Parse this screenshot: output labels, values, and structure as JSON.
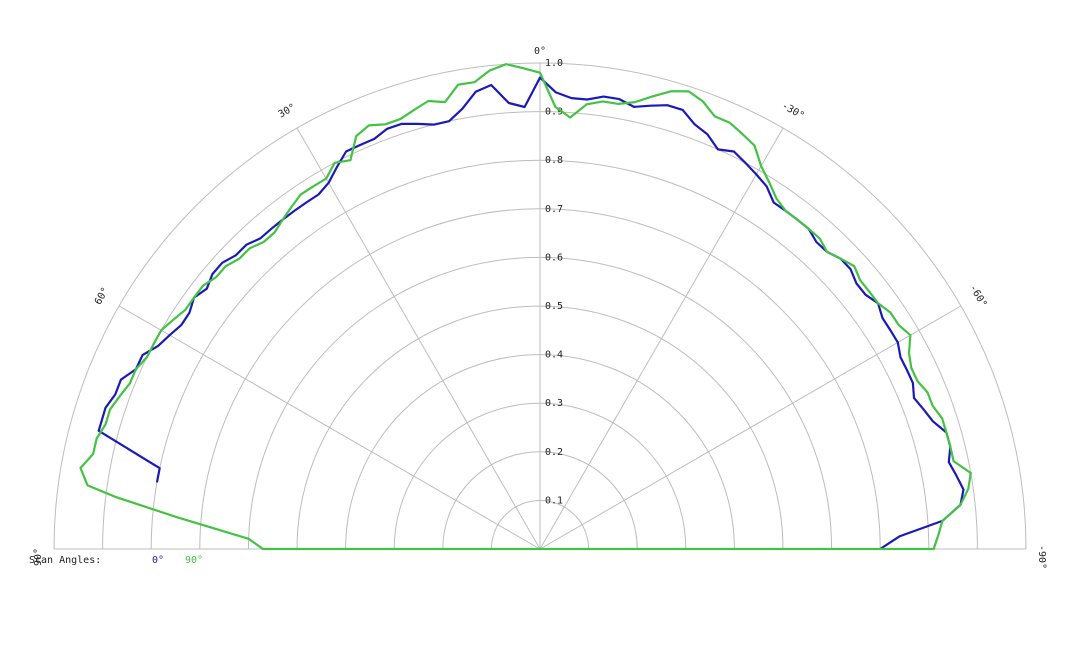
{
  "chart_data": {
    "type": "polar-line",
    "radial_range": [
      0,
      1.0
    ],
    "radial_ticks": [
      0.1,
      0.2,
      0.3,
      0.4,
      0.5,
      0.6,
      0.7,
      0.8,
      0.9,
      1.0
    ],
    "radial_tick_labels": [
      "0.1",
      "0.2",
      "0.3",
      "0.4",
      "0.5",
      "0.6",
      "0.7",
      "0.8",
      "0.9",
      "1.0"
    ],
    "angle_range": [
      -90,
      90
    ],
    "angle_ticks": [
      90,
      60,
      30,
      0,
      -30,
      -60,
      -90
    ],
    "angle_tick_labels": [
      "90°",
      "60°",
      "30°",
      "0°",
      "-30°",
      "-60°",
      "-90°"
    ],
    "grid": true,
    "legend": {
      "title": "Scan Angles:",
      "placement": "bottom-left",
      "entries": [
        "0°",
        "90°"
      ]
    },
    "series": [
      {
        "name": "0°",
        "color": "#1a1ab8",
        "points": [
          [
            80,
            0.8
          ],
          [
            78,
            0.8
          ],
          [
            75,
            0.94
          ],
          [
            72,
            0.94
          ],
          [
            70,
            0.93
          ],
          [
            68,
            0.93
          ],
          [
            66,
            0.91
          ],
          [
            64,
            0.91
          ],
          [
            62,
            0.89
          ],
          [
            60,
            0.88
          ],
          [
            58,
            0.87
          ],
          [
            56,
            0.87
          ],
          [
            54,
            0.88
          ],
          [
            52,
            0.87
          ],
          [
            50,
            0.88
          ],
          [
            48,
            0.88
          ],
          [
            46,
            0.87
          ],
          [
            44,
            0.87
          ],
          [
            42,
            0.86
          ],
          [
            40,
            0.86
          ],
          [
            38,
            0.86
          ],
          [
            36,
            0.86
          ],
          [
            34,
            0.86
          ],
          [
            32,
            0.86
          ],
          [
            30,
            0.87
          ],
          [
            28,
            0.89
          ],
          [
            26,
            0.91
          ],
          [
            24,
            0.91
          ],
          [
            22,
            0.91
          ],
          [
            20,
            0.92
          ],
          [
            18,
            0.92
          ],
          [
            16,
            0.91
          ],
          [
            14,
            0.9
          ],
          [
            12,
            0.9
          ],
          [
            10,
            0.92
          ],
          [
            8,
            0.95
          ],
          [
            6,
            0.96
          ],
          [
            4,
            0.92
          ],
          [
            2,
            0.91
          ],
          [
            0,
            0.97
          ],
          [
            -2,
            0.94
          ],
          [
            -4,
            0.93
          ],
          [
            -6,
            0.93
          ],
          [
            -8,
            0.94
          ],
          [
            -10,
            0.94
          ],
          [
            -12,
            0.93
          ],
          [
            -14,
            0.94
          ],
          [
            -16,
            0.95
          ],
          [
            -18,
            0.95
          ],
          [
            -20,
            0.93
          ],
          [
            -22,
            0.92
          ],
          [
            -24,
            0.9
          ],
          [
            -26,
            0.91
          ],
          [
            -28,
            0.9
          ],
          [
            -30,
            0.89
          ],
          [
            -32,
            0.88
          ],
          [
            -34,
            0.86
          ],
          [
            -36,
            0.86
          ],
          [
            -38,
            0.86
          ],
          [
            -40,
            0.86
          ],
          [
            -42,
            0.85
          ],
          [
            -44,
            0.85
          ],
          [
            -46,
            0.86
          ],
          [
            -48,
            0.86
          ],
          [
            -50,
            0.85
          ],
          [
            -52,
            0.85
          ],
          [
            -54,
            0.86
          ],
          [
            -56,
            0.85
          ],
          [
            -58,
            0.85
          ],
          [
            -60,
            0.85
          ],
          [
            -62,
            0.84
          ],
          [
            -64,
            0.84
          ],
          [
            -66,
            0.84
          ],
          [
            -68,
            0.83
          ],
          [
            -70,
            0.84
          ],
          [
            -72,
            0.85
          ],
          [
            -74,
            0.87
          ],
          [
            -76,
            0.87
          ],
          [
            -78,
            0.86
          ],
          [
            -80,
            0.87
          ],
          [
            -82,
            0.88
          ],
          [
            -84,
            0.87
          ],
          [
            -86,
            0.83
          ],
          [
            -88,
            0.74
          ],
          [
            -90,
            0.7
          ]
        ]
      },
      {
        "name": "90°",
        "color": "#44c244",
        "points": [
          [
            90,
            0.57
          ],
          [
            88,
            0.6
          ],
          [
            85,
            0.75
          ],
          [
            83,
            0.88
          ],
          [
            82,
            0.94
          ],
          [
            80,
            0.96
          ],
          [
            78,
            0.94
          ],
          [
            76,
            0.94
          ],
          [
            74,
            0.93
          ],
          [
            72,
            0.93
          ],
          [
            70,
            0.92
          ],
          [
            68,
            0.91
          ],
          [
            66,
            0.91
          ],
          [
            64,
            0.9
          ],
          [
            62,
            0.9
          ],
          [
            60,
            0.9
          ],
          [
            58,
            0.89
          ],
          [
            56,
            0.88
          ],
          [
            54,
            0.88
          ],
          [
            52,
            0.88
          ],
          [
            50,
            0.87
          ],
          [
            48,
            0.87
          ],
          [
            46,
            0.86
          ],
          [
            44,
            0.86
          ],
          [
            42,
            0.85
          ],
          [
            40,
            0.85
          ],
          [
            38,
            0.86
          ],
          [
            36,
            0.87
          ],
          [
            34,
            0.88
          ],
          [
            32,
            0.88
          ],
          [
            30,
            0.88
          ],
          [
            28,
            0.9
          ],
          [
            26,
            0.89
          ],
          [
            24,
            0.93
          ],
          [
            22,
            0.94
          ],
          [
            20,
            0.93
          ],
          [
            18,
            0.93
          ],
          [
            16,
            0.94
          ],
          [
            14,
            0.95
          ],
          [
            12,
            0.94
          ],
          [
            10,
            0.97
          ],
          [
            8,
            0.97
          ],
          [
            6,
            0.99
          ],
          [
            4,
            1.0
          ],
          [
            2,
            0.99
          ],
          [
            0,
            0.98
          ],
          [
            -2,
            0.91
          ],
          [
            -4,
            0.89
          ],
          [
            -6,
            0.92
          ],
          [
            -8,
            0.93
          ],
          [
            -10,
            0.93
          ],
          [
            -12,
            0.94
          ],
          [
            -14,
            0.96
          ],
          [
            -16,
            0.98
          ],
          [
            -18,
            0.99
          ],
          [
            -20,
            0.98
          ],
          [
            -22,
            0.96
          ],
          [
            -24,
            0.96
          ],
          [
            -26,
            0.95
          ],
          [
            -28,
            0.94
          ],
          [
            -30,
            0.91
          ],
          [
            -32,
            0.89
          ],
          [
            -34,
            0.87
          ],
          [
            -36,
            0.86
          ],
          [
            -38,
            0.86
          ],
          [
            -40,
            0.86
          ],
          [
            -42,
            0.86
          ],
          [
            -44,
            0.85
          ],
          [
            -46,
            0.86
          ],
          [
            -48,
            0.87
          ],
          [
            -50,
            0.86
          ],
          [
            -52,
            0.86
          ],
          [
            -54,
            0.86
          ],
          [
            -56,
            0.87
          ],
          [
            -58,
            0.87
          ],
          [
            -60,
            0.88
          ],
          [
            -62,
            0.86
          ],
          [
            -64,
            0.85
          ],
          [
            -66,
            0.85
          ],
          [
            -68,
            0.86
          ],
          [
            -70,
            0.86
          ],
          [
            -72,
            0.87
          ],
          [
            -74,
            0.87
          ],
          [
            -76,
            0.87
          ],
          [
            -78,
            0.87
          ],
          [
            -80,
            0.9
          ],
          [
            -82,
            0.89
          ],
          [
            -84,
            0.87
          ],
          [
            -86,
            0.83
          ],
          [
            -88,
            0.82
          ],
          [
            -90,
            0.81
          ]
        ]
      },
      {
        "name": "90°",
        "color": "#44c244",
        "points": [
          [
            90,
            0.57
          ],
          [
            -90,
            0.81
          ]
        ]
      }
    ]
  }
}
